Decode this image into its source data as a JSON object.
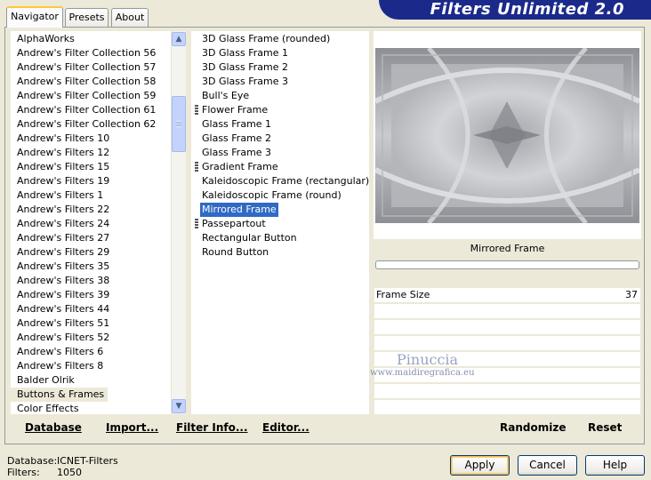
{
  "tabs": [
    {
      "label": "Navigator"
    },
    {
      "label": "Presets"
    },
    {
      "label": "About"
    }
  ],
  "app_title": "Filters Unlimited 2.0",
  "categories": [
    "AlphaWorks",
    "Andrew's Filter Collection 56",
    "Andrew's Filter Collection 57",
    "Andrew's Filter Collection 58",
    "Andrew's Filter Collection 59",
    "Andrew's Filter Collection 61",
    "Andrew's Filter Collection 62",
    "Andrew's Filters 10",
    "Andrew's Filters 12",
    "Andrew's Filters 15",
    "Andrew's Filters 19",
    "Andrew's Filters 1",
    "Andrew's Filters 22",
    "Andrew's Filters 24",
    "Andrew's Filters 27",
    "Andrew's Filters 29",
    "Andrew's Filters 35",
    "Andrew's Filters 38",
    "Andrew's Filters 39",
    "Andrew's Filters 44",
    "Andrew's Filters 51",
    "Andrew's Filters 52",
    "Andrew's Filters 6",
    "Andrew's Filters 8",
    "Balder Olrik",
    "Buttons & Frames",
    "Color Effects"
  ],
  "selected_category": "Buttons & Frames",
  "filters": [
    {
      "label": "3D Glass Frame (rounded)",
      "marker": false
    },
    {
      "label": "3D Glass Frame 1",
      "marker": false
    },
    {
      "label": "3D Glass Frame 2",
      "marker": false
    },
    {
      "label": "3D Glass Frame 3",
      "marker": false
    },
    {
      "label": "Bull's Eye",
      "marker": false
    },
    {
      "label": "Flower Frame",
      "marker": true
    },
    {
      "label": "Glass Frame 1",
      "marker": false
    },
    {
      "label": "Glass Frame 2",
      "marker": false
    },
    {
      "label": "Glass Frame 3",
      "marker": false
    },
    {
      "label": "Gradient Frame",
      "marker": true
    },
    {
      "label": "Kaleidoscopic Frame (rectangular)",
      "marker": false
    },
    {
      "label": "Kaleidoscopic Frame (round)",
      "marker": false
    },
    {
      "label": "Mirrored Frame",
      "marker": false
    },
    {
      "label": "Passepartout",
      "marker": true
    },
    {
      "label": "Rectangular Button",
      "marker": false
    },
    {
      "label": "Round Button",
      "marker": false
    }
  ],
  "selected_filter": "Mirrored Frame",
  "preview": {
    "filter_name": "Mirrored Frame",
    "progress": 0
  },
  "params": [
    {
      "label": "Frame Size",
      "value": "37"
    }
  ],
  "watermark": {
    "name": "Pinuccia",
    "url": "www.maidiregrafica.eu"
  },
  "bottom_links": {
    "database": "Database",
    "import": "Import...",
    "filter_info": "Filter Info...",
    "editor": "Editor...",
    "randomize": "Randomize",
    "reset": "Reset"
  },
  "status": {
    "database_label": "Database:",
    "database_value": "ICNET-Filters",
    "filters_label": "Filters:",
    "filters_value": "1050"
  },
  "buttons": {
    "apply": "Apply",
    "cancel": "Cancel",
    "help": "Help"
  }
}
